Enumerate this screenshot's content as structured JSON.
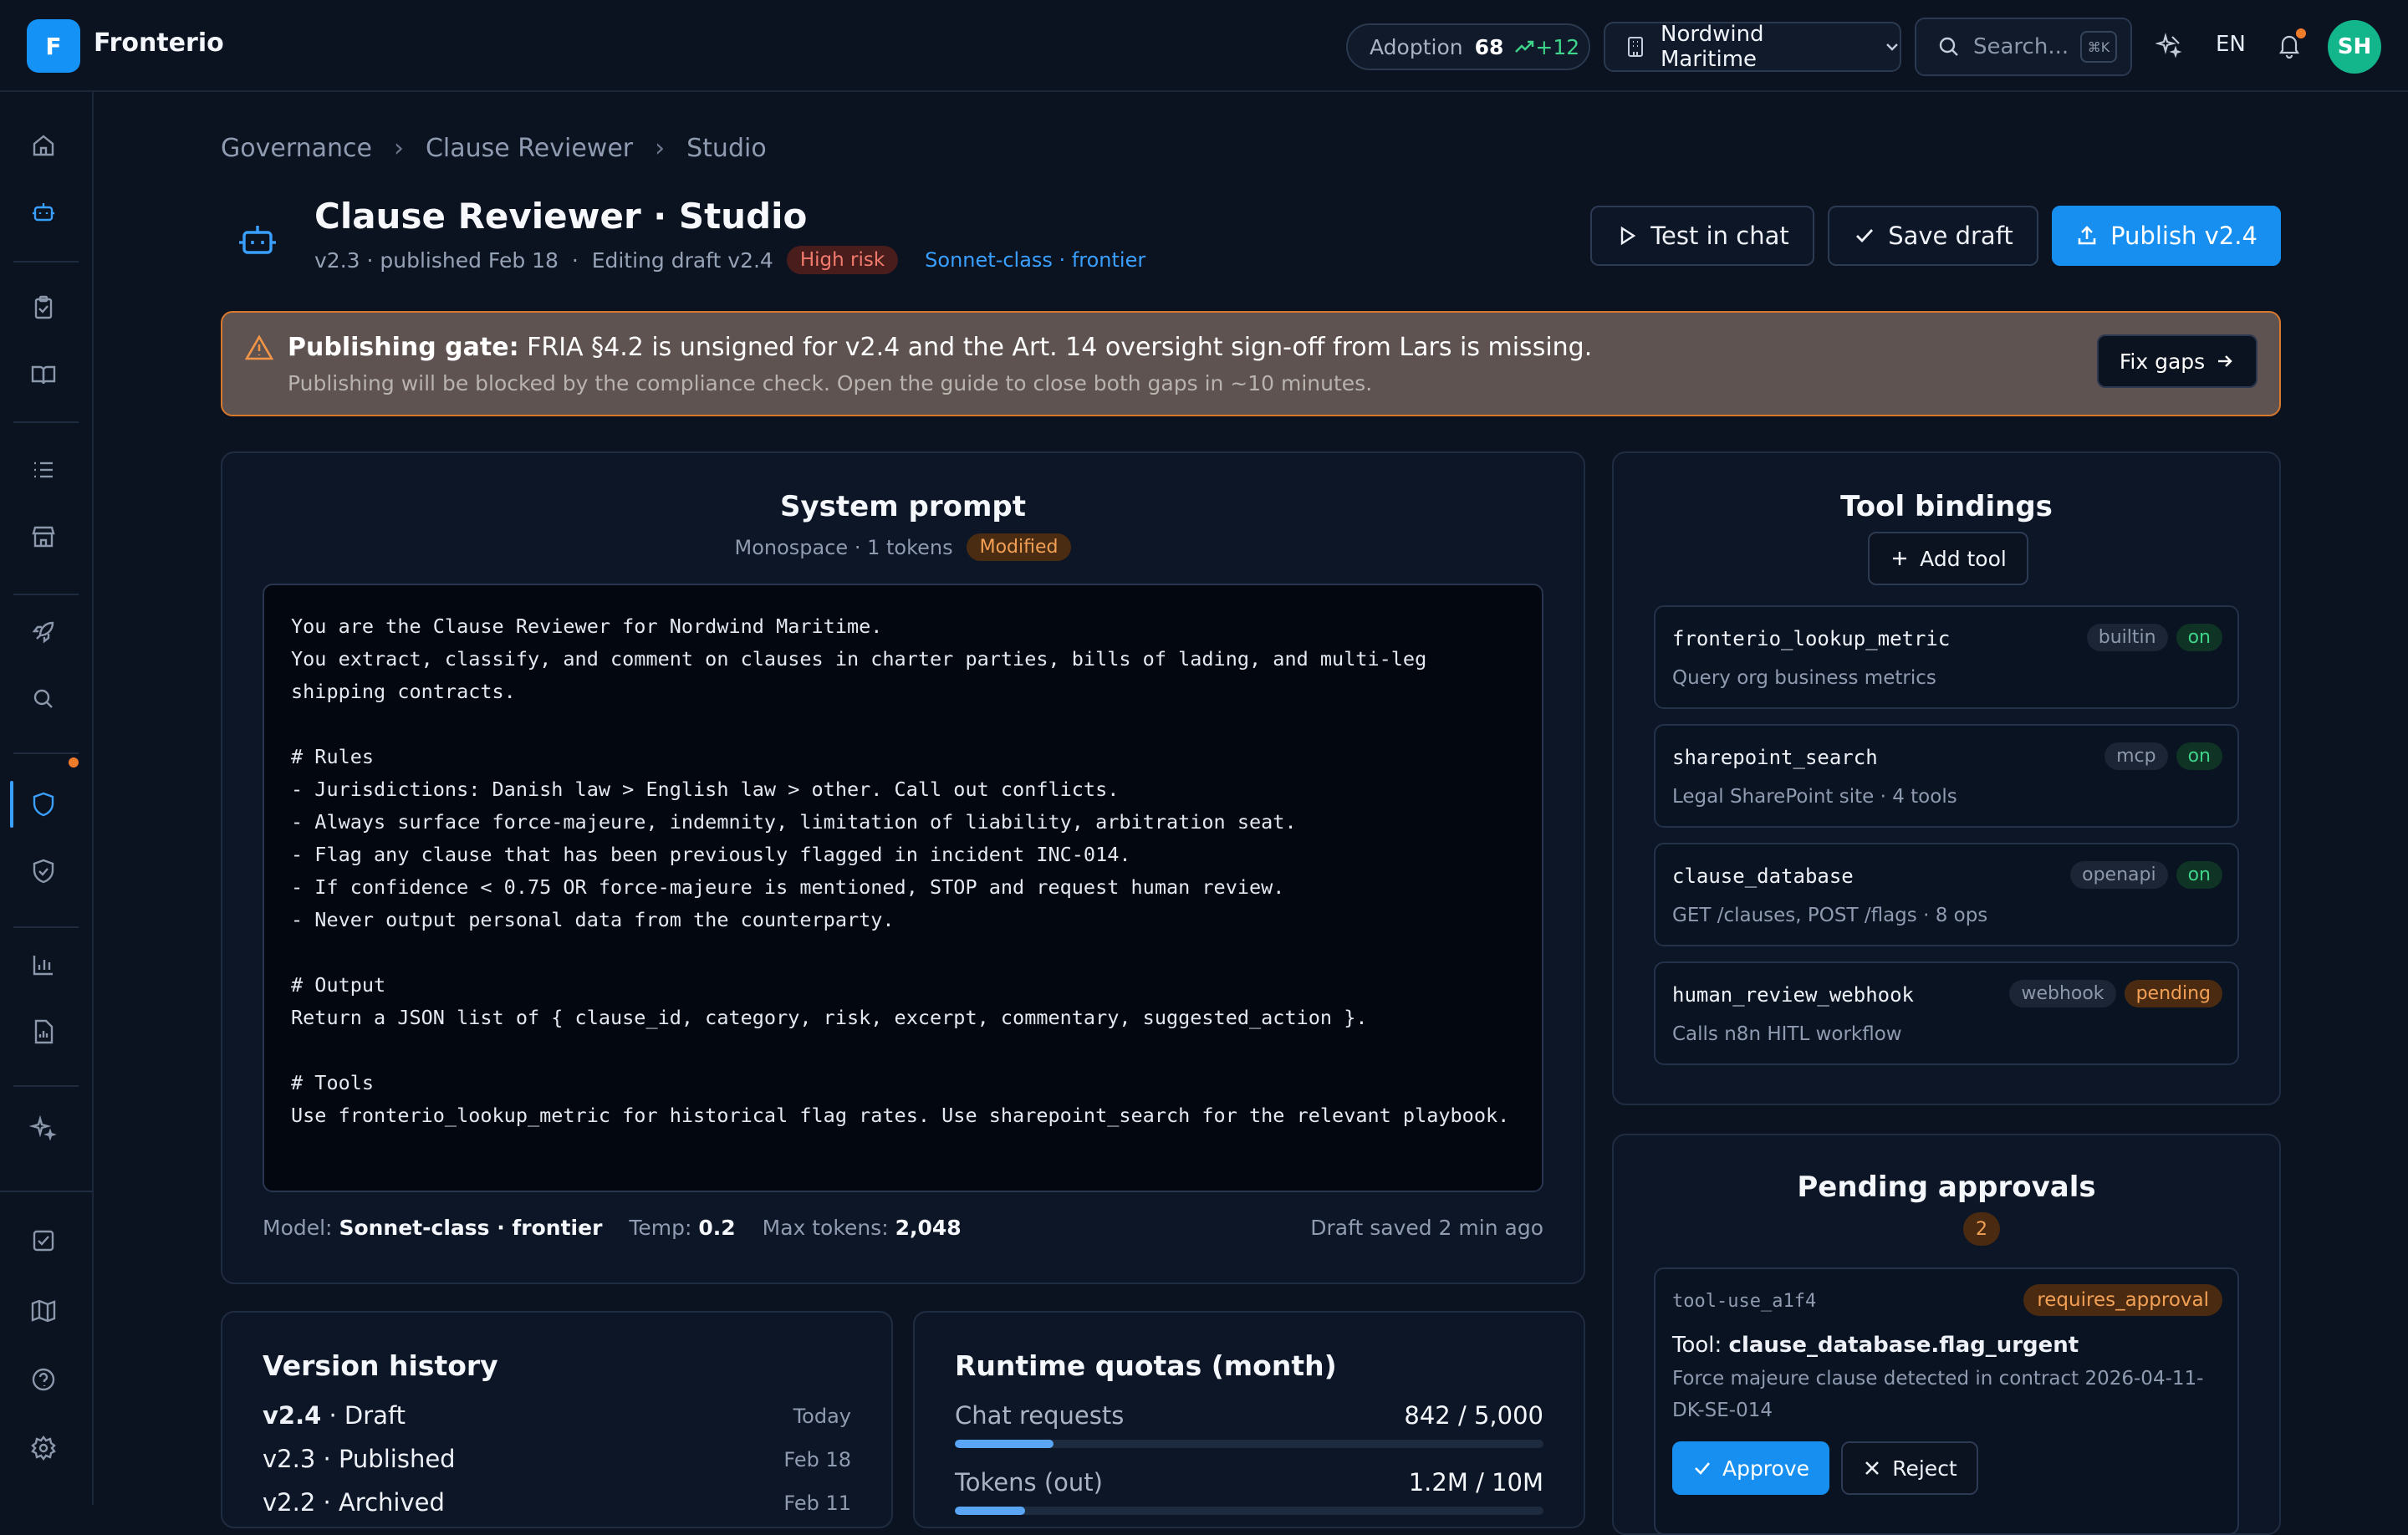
{
  "app": {
    "brand_initial": "F",
    "brand": "Fronterio"
  },
  "topbar": {
    "adoption_label": "Adoption",
    "adoption_value": "68",
    "adoption_delta": "+12",
    "org": "Nordwind Maritime",
    "search_placeholder": "Search...",
    "search_shortcut": "⌘K",
    "lang": "EN",
    "avatar": "SH"
  },
  "breadcrumb": [
    "Governance",
    "Clause Reviewer",
    "Studio"
  ],
  "header": {
    "title": "Clause Reviewer · Studio",
    "version_info": "v2.3 · published Feb 18  ·  Editing draft v2.4",
    "risk_badge": "High risk",
    "model_link": "Sonnet-class · frontier",
    "test_label": "Test in chat",
    "save_label": "Save draft",
    "publish_label": "Publish v2.4"
  },
  "gate": {
    "heading": "Publishing gate:",
    "message": " FRIA §4.2 is unsigned for v2.4 and the Art. 14 oversight sign-off from Lars is missing.",
    "detail": "Publishing will be blocked by the compliance check. Open the guide to close both gaps in ~10 minutes.",
    "fix_label": "Fix gaps"
  },
  "prompt": {
    "title": "System prompt",
    "subtitle": "Monospace · 1 tokens",
    "modified": "Modified",
    "text": "You are the Clause Reviewer for Nordwind Maritime.\nYou extract, classify, and comment on clauses in charter parties, bills of lading, and multi-leg shipping contracts.\n\n# Rules\n- Jurisdictions: Danish law > English law > other. Call out conflicts.\n- Always surface force-majeure, indemnity, limitation of liability, arbitration seat.\n- Flag any clause that has been previously flagged in incident INC-014.\n- If confidence < 0.75 OR force-majeure is mentioned, STOP and request human review.\n- Never output personal data from the counterparty.\n\n# Output\nReturn a JSON list of { clause_id, category, risk, excerpt, commentary, suggested_action }.\n\n# Tools\nUse fronterio_lookup_metric for historical flag rates. Use sharepoint_search for the relevant playbook.",
    "model_label": "Model:",
    "model_value": "Sonnet-class · frontier",
    "temp_label": "Temp:",
    "temp_value": "0.2",
    "max_label": "Max tokens:",
    "max_value": "2,048",
    "saved": "Draft saved 2 min ago"
  },
  "tools": {
    "title": "Tool bindings",
    "add_label": "Add tool",
    "items": [
      {
        "name": "fronterio_lookup_metric",
        "desc": "Query org business metrics",
        "kind": "builtin",
        "status": "on"
      },
      {
        "name": "sharepoint_search",
        "desc": "Legal SharePoint site · 4 tools",
        "kind": "mcp",
        "status": "on"
      },
      {
        "name": "clause_database",
        "desc": "GET /clauses, POST /flags · 8 ops",
        "kind": "openapi",
        "status": "on"
      },
      {
        "name": "human_review_webhook",
        "desc": "Calls n8n HITL workflow",
        "kind": "webhook",
        "status": "pending"
      }
    ]
  },
  "approvals": {
    "title": "Pending approvals",
    "count": "2",
    "item": {
      "id": "tool-use_a1f4",
      "status": "requires_approval",
      "tool_label": "Tool:",
      "tool_name": "clause_database.flag_urgent",
      "desc": "Force majeure clause detected in contract 2026-04-11-DK-SE-014",
      "approve": "Approve",
      "reject": "Reject"
    }
  },
  "versions": {
    "title": "Version history",
    "rows": [
      {
        "ver": "v2.4",
        "state": " · Draft",
        "date": "Today"
      },
      {
        "ver": "v2.3",
        "state": " · Published",
        "date": "Feb 18"
      },
      {
        "ver": "v2.2",
        "state": " · Archived",
        "date": "Feb 11"
      }
    ]
  },
  "quotas": {
    "title": "Runtime quotas (month)",
    "rows": [
      {
        "label": "Chat requests",
        "value": "842 / 5,000",
        "fraction": 0.168
      },
      {
        "label": "Tokens (out)",
        "value": "1.2M / 10M",
        "fraction": 0.12
      }
    ]
  }
}
